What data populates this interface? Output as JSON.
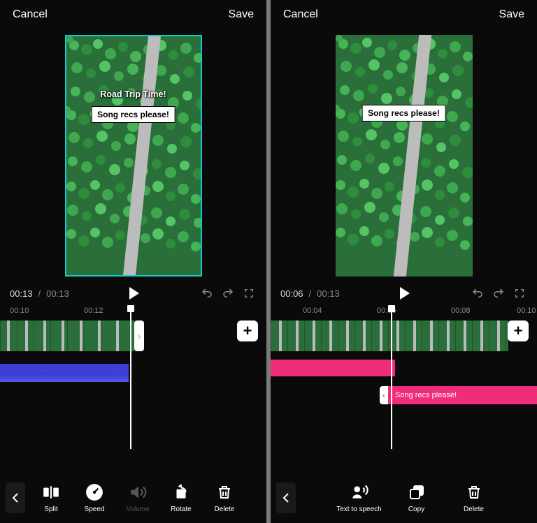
{
  "left": {
    "header": {
      "cancel": "Cancel",
      "save": "Save"
    },
    "overlayA": "Road Trip Time!",
    "overlayB": "Song recs please!",
    "player": {
      "current": "00:13",
      "total": "00:13"
    },
    "ruler": [
      "00:10",
      "00:12"
    ],
    "tools": {
      "split": "Split",
      "speed": "Speed",
      "volume": "Volume",
      "rotate": "Rotate",
      "delete": "Delete"
    }
  },
  "right": {
    "header": {
      "cancel": "Cancel",
      "save": "Save"
    },
    "overlayB": "Song recs please!",
    "player": {
      "current": "00:06",
      "total": "00:13"
    },
    "ruler": [
      "00:04",
      "00:06",
      "00:08",
      "00:10"
    ],
    "textTrack": "Song recs please!",
    "tools": {
      "tts": "Text to speech",
      "copy": "Copy",
      "delete": "Delete"
    }
  },
  "add": "+"
}
